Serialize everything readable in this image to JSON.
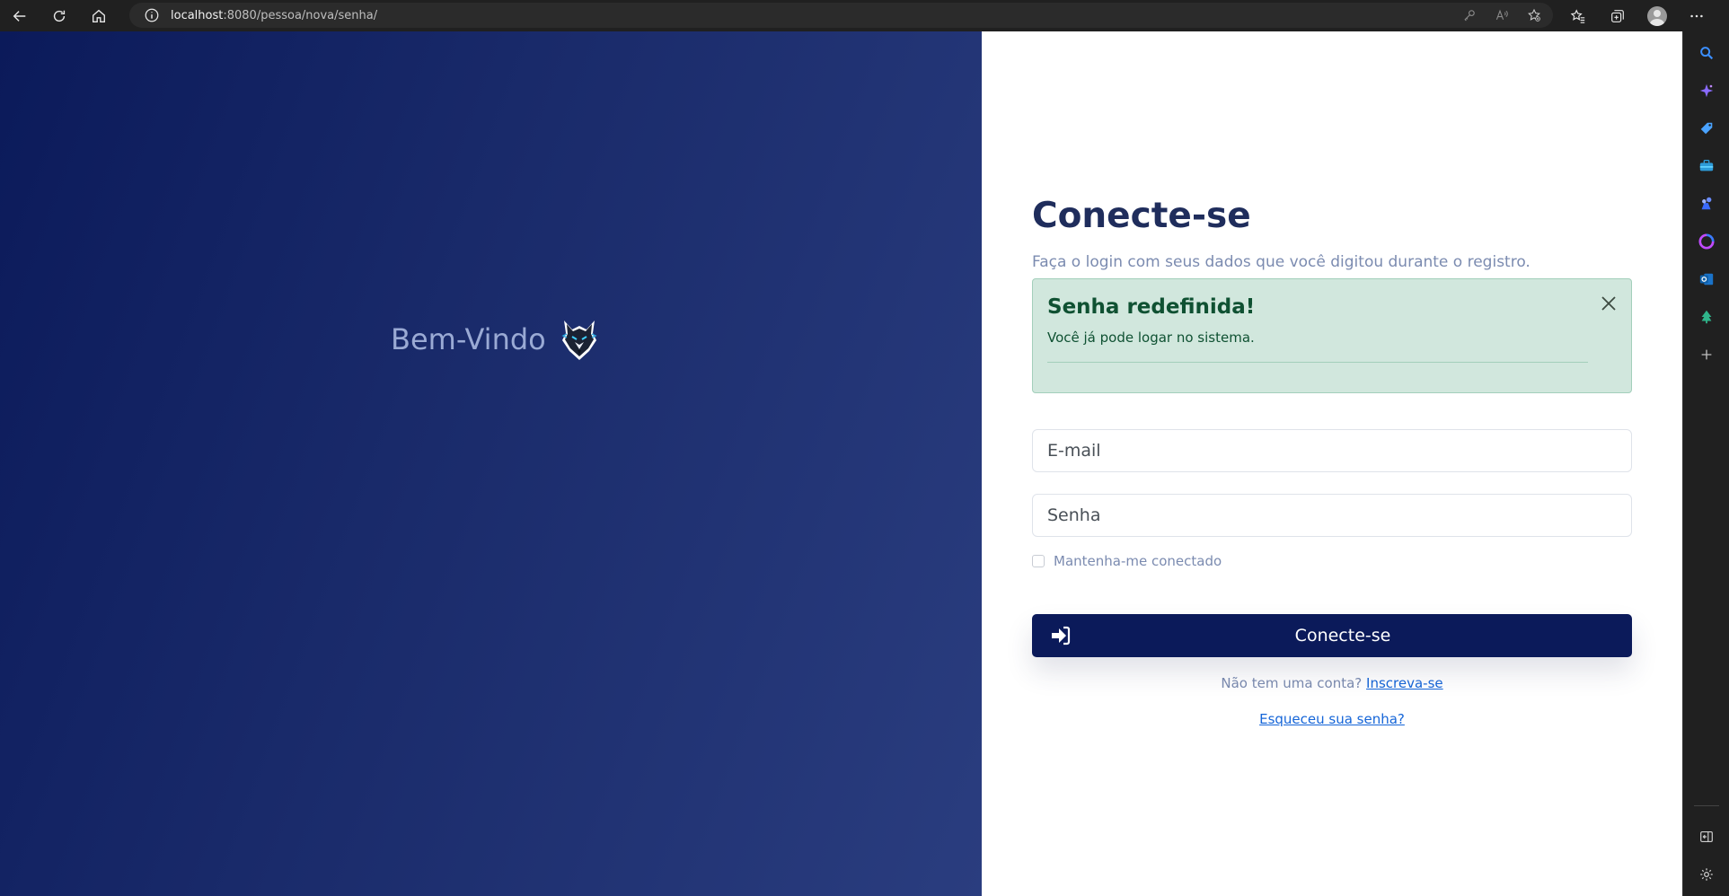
{
  "browser": {
    "url_host": "localhost",
    "url_rest": ":8080/pessoa/nova/senha/",
    "nav_icons": [
      "back-icon",
      "refresh-icon",
      "home-icon"
    ],
    "address_icons": [
      "info-icon",
      "key-icon",
      "read-aloud-icon",
      "add-favorite-icon"
    ],
    "toolbar_icons": [
      "favorites-icon",
      "collections-icon",
      "profile-avatar",
      "more-icon"
    ],
    "sidebar_icons": [
      "search-icon",
      "copilot-icon",
      "shopping-icon",
      "tools-icon",
      "games-icon",
      "office-icon",
      "outlook-icon",
      "tree-icon",
      "add-icon"
    ],
    "sidebar_bottom_icons": [
      "hide-sidebar-icon",
      "settings-icon"
    ]
  },
  "left_panel": {
    "welcome": "Bem-Vindo",
    "logo": "wolf-logo",
    "gradient_colors": [
      "#0b1a5a",
      "#2a3d7f"
    ]
  },
  "login": {
    "title": "Conecte-se",
    "subtitle": "Faça o login com seus dados que você digitou durante o registro.",
    "alert": {
      "title": "Senha redefinida!",
      "text": "Você já pode logar no sistema.",
      "color": "#d1e7dd"
    },
    "email_placeholder": "E-mail",
    "password_placeholder": "Senha",
    "remember_label": "Mantenha-me conectado",
    "submit_label": "Conecte-se",
    "submit_color": "#0b1a5a",
    "signup_prompt": "Não tem uma conta?",
    "signup_link": "Inscreva-se",
    "forgot_link": "Esqueceu sua senha?"
  }
}
